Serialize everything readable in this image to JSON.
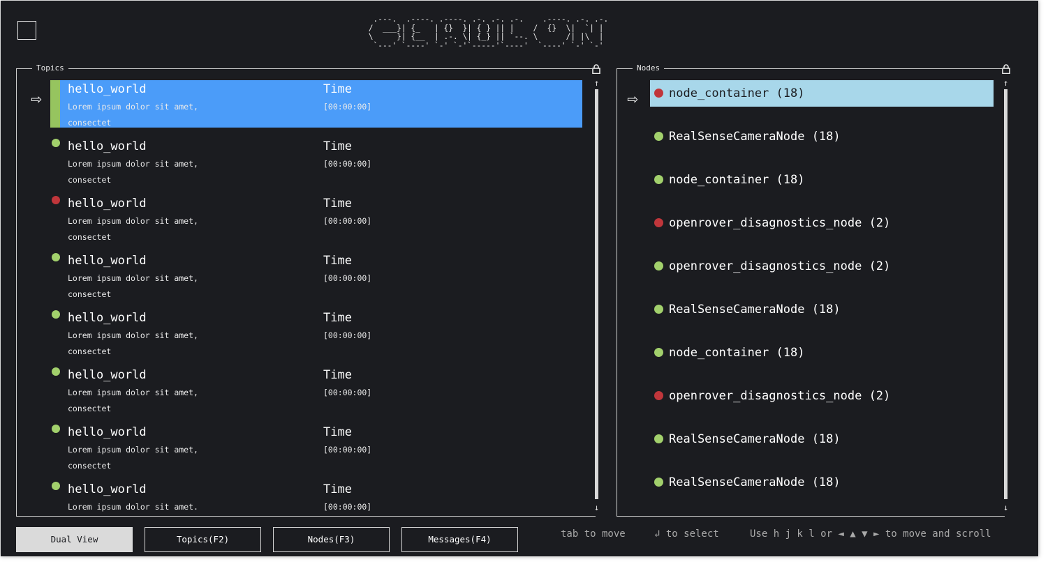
{
  "logo_ascii": "  .---.  .----. .----. .-. .-. .-.    .----. .-. .-.\n /  ___}| {_   | {}  }| { } || |    /  {}  \\|  `| |\n \\     }| {__  | .-. \\| {_} || `--. \\      /| |\\  |\n  `---' `----' `-' `-'`-----'`----'  `----' `-' `-'",
  "topics": {
    "title": "Topics",
    "items": [
      {
        "name": "hello_world",
        "desc": "Lorem ipsum dolor sit amet, consectet",
        "time_label": "Time",
        "time": "[00:00:00]",
        "status": "green",
        "selected": true
      },
      {
        "name": "hello_world",
        "desc": "Lorem ipsum dolor sit amet, consectet",
        "time_label": "Time",
        "time": "[00:00:00]",
        "status": "green",
        "selected": false
      },
      {
        "name": "hello_world",
        "desc": "Lorem ipsum dolor sit amet, consectet",
        "time_label": "Time",
        "time": "[00:00:00]",
        "status": "red",
        "selected": false
      },
      {
        "name": "hello_world",
        "desc": "Lorem ipsum dolor sit amet, consectet",
        "time_label": "Time",
        "time": "[00:00:00]",
        "status": "green",
        "selected": false
      },
      {
        "name": "hello_world",
        "desc": "Lorem ipsum dolor sit amet, consectet",
        "time_label": "Time",
        "time": "[00:00:00]",
        "status": "green",
        "selected": false
      },
      {
        "name": "hello_world",
        "desc": "Lorem ipsum dolor sit amet, consectet",
        "time_label": "Time",
        "time": "[00:00:00]",
        "status": "green",
        "selected": false
      },
      {
        "name": "hello_world",
        "desc": "Lorem ipsum dolor sit amet, consectet",
        "time_label": "Time",
        "time": "[00:00:00]",
        "status": "green",
        "selected": false
      },
      {
        "name": "hello_world",
        "desc": "Lorem ipsum dolor sit amet.",
        "time_label": "Time",
        "time": "[00:00:00]",
        "status": "green",
        "selected": false
      }
    ]
  },
  "nodes": {
    "title": "Nodes",
    "items": [
      {
        "label": "node_container (18)",
        "status": "red",
        "selected": true
      },
      {
        "label": "RealSenseCameraNode (18)",
        "status": "green",
        "selected": false
      },
      {
        "label": "node_container (18)",
        "status": "green",
        "selected": false
      },
      {
        "label": "openrover_disagnostics_node (2)",
        "status": "red",
        "selected": false
      },
      {
        "label": "openrover_disagnostics_node (2)",
        "status": "green",
        "selected": false
      },
      {
        "label": "RealSenseCameraNode (18)",
        "status": "green",
        "selected": false
      },
      {
        "label": "node_container (18)",
        "status": "green",
        "selected": false
      },
      {
        "label": "openrover_disagnostics_node (2)",
        "status": "red",
        "selected": false
      },
      {
        "label": "RealSenseCameraNode (18)",
        "status": "green",
        "selected": false
      },
      {
        "label": "RealSenseCameraNode (18)",
        "status": "green",
        "selected": false
      }
    ]
  },
  "tabs": [
    {
      "label": "Dual View",
      "active": true
    },
    {
      "label": "Topics(F2)",
      "active": false
    },
    {
      "label": "Nodes(F3)",
      "active": false
    },
    {
      "label": "Messages(F4)",
      "active": false
    }
  ],
  "hints": {
    "tab": "tab to move",
    "select": "↲ to select",
    "move": "Use h j k l or ◄ ▲ ▼ ► to move and scroll"
  },
  "icons": {
    "pointer": "right-arrow-icon",
    "lock": "lock-icon",
    "scroll_up": "↑",
    "scroll_down": "↓"
  },
  "colors": {
    "background": "#1b1c20",
    "topic_selected": "#4b9cf9",
    "node_selected": "#a8d7ea",
    "status_green": "#a2d06c",
    "status_red": "#c0363b",
    "selection_bar": "#96c45f"
  }
}
